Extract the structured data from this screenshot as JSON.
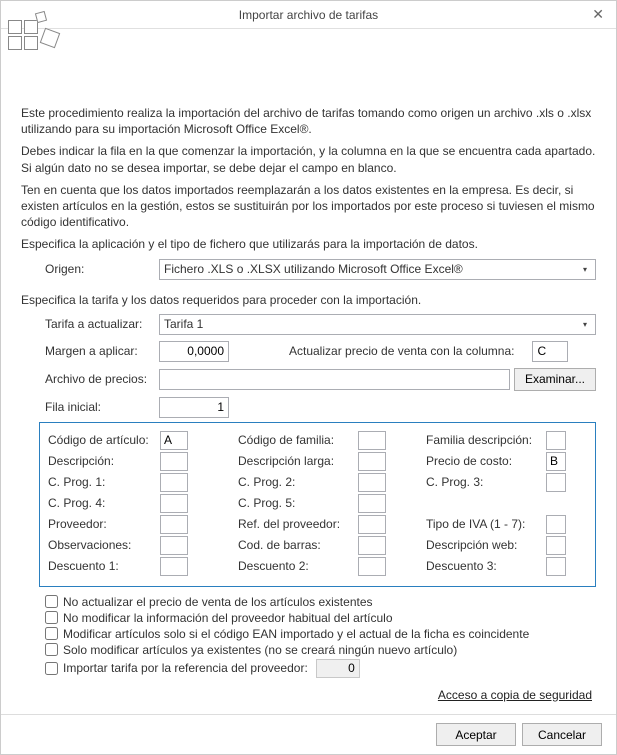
{
  "title": "Importar archivo de tarifas",
  "paragraphs": {
    "p1": "Este procedimiento realiza la importación del archivo de tarifas tomando como origen un archivo .xls o .xlsx utilizando para su importación Microsoft Office Excel®.",
    "p2": "Debes indicar la fila en la que comenzar la importación, y la columna en la que se encuentra cada apartado. Si algún dato no se desea importar, se debe dejar el campo en blanco.",
    "p3": "Ten en cuenta que los datos importados reemplazarán a los datos existentes en la empresa. Es decir, si existen artículos en la gestión, estos se sustituirán por los importados por este proceso si tuviesen el mismo código identificativo.",
    "p4": "Especifica la aplicación y el tipo de fichero que utilizarás para la importación de datos.",
    "p5": "Especifica la tarifa y los datos requeridos para proceder con la importación."
  },
  "origen": {
    "label": "Origen:",
    "value": "Fichero .XLS o .XLSX utilizando Microsoft Office Excel®"
  },
  "tarifa": {
    "label": "Tarifa a actualizar:",
    "value": "Tarifa 1"
  },
  "margen": {
    "label": "Margen a aplicar:",
    "value": "0,0000"
  },
  "actualizar_col": {
    "label": "Actualizar precio de venta con la columna:",
    "value": "C"
  },
  "archivo": {
    "label": "Archivo de precios:",
    "value": "",
    "button": "Examinar..."
  },
  "fila_inicial": {
    "label": "Fila inicial:",
    "value": "1"
  },
  "grid": {
    "codigo_articulo": {
      "label": "Código de artículo:",
      "value": "A"
    },
    "codigo_familia": {
      "label": "Código de familia:",
      "value": ""
    },
    "familia_desc": {
      "label": "Familia descripción:",
      "value": ""
    },
    "descripcion": {
      "label": "Descripción:",
      "value": ""
    },
    "descripcion_larga": {
      "label": "Descripción larga:",
      "value": ""
    },
    "precio_costo": {
      "label": "Precio de costo:",
      "value": "B"
    },
    "cprog1": {
      "label": "C. Prog. 1:",
      "value": ""
    },
    "cprog2": {
      "label": "C. Prog. 2:",
      "value": ""
    },
    "cprog3": {
      "label": "C. Prog. 3:",
      "value": ""
    },
    "cprog4": {
      "label": "C. Prog. 4:",
      "value": ""
    },
    "cprog5": {
      "label": "C. Prog. 5:",
      "value": ""
    },
    "proveedor": {
      "label": "Proveedor:",
      "value": ""
    },
    "ref_proveedor": {
      "label": "Ref. del proveedor:",
      "value": ""
    },
    "tipo_iva": {
      "label": "Tipo de IVA (1 - 7):",
      "value": ""
    },
    "observaciones": {
      "label": "Observaciones:",
      "value": ""
    },
    "cod_barras": {
      "label": "Cod. de barras:",
      "value": ""
    },
    "desc_web": {
      "label": "Descripción web:",
      "value": ""
    },
    "desc1": {
      "label": "Descuento 1:",
      "value": ""
    },
    "desc2": {
      "label": "Descuento 2:",
      "value": ""
    },
    "desc3": {
      "label": "Descuento 3:",
      "value": ""
    }
  },
  "checks": {
    "c1": "No actualizar el precio de venta de los artículos existentes",
    "c2": "No modificar la información del proveedor habitual del artículo",
    "c3": "Modificar artículos solo si el código EAN importado y el actual de la ficha es coincidente",
    "c4": "Solo modificar artículos ya existentes (no se creará ningún nuevo artículo)",
    "c5": "Importar tarifa por la referencia del proveedor:",
    "c5value": "0"
  },
  "link_backup": "Acceso a copia de seguridad",
  "footer": {
    "ok": "Aceptar",
    "cancel": "Cancelar"
  }
}
